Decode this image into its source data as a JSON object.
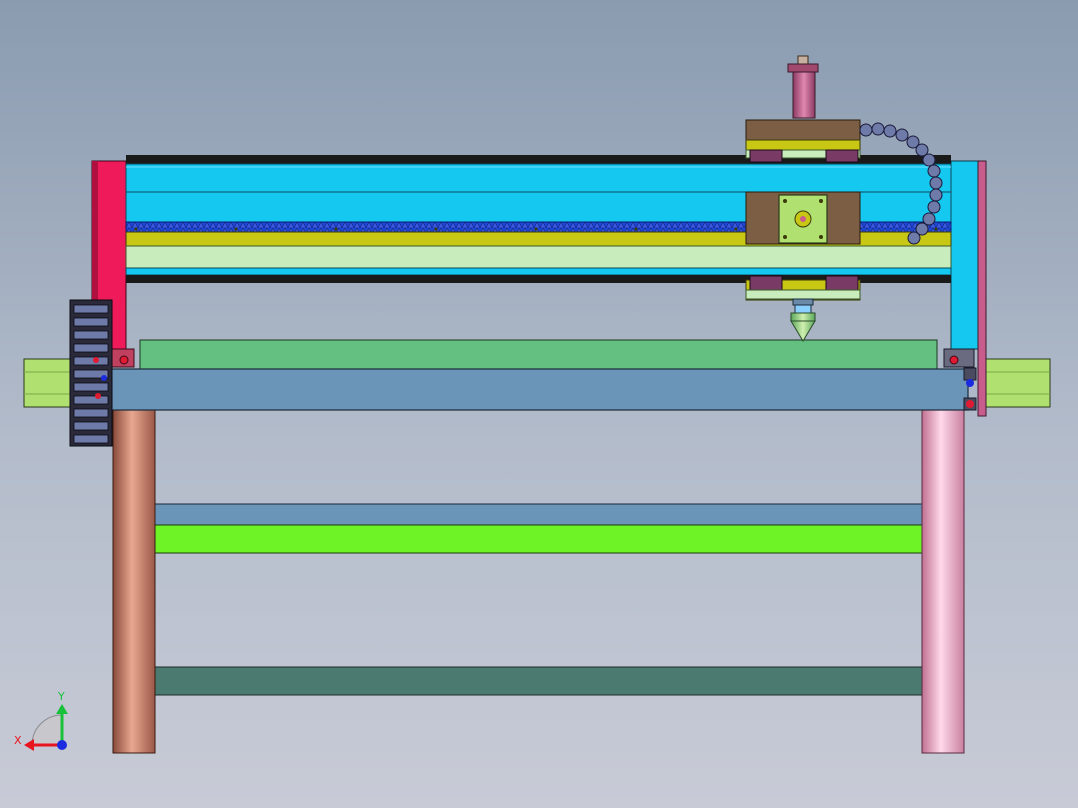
{
  "view": {
    "background_top": "#8a9bb0",
    "background_bottom": "#c8cbd6"
  },
  "triad": {
    "x_label": "X",
    "y_label": "Y",
    "x_color": "#e8141e",
    "y_color": "#17c23a",
    "z_color": "#1a2be0"
  },
  "palette": {
    "gantry_beam": "#14c8f0",
    "left_plate": "#ee1a5a",
    "right_plate": "#14c8f0",
    "gear_rack": "#1e46d2",
    "yellow_rail": "#c8c814",
    "linear_rail": "#c8ecbc",
    "carriage_plate": "#7c5e44",
    "stepper_motor": "#b0e070",
    "spindle_motor": "#c85c8c",
    "drag_chain": "#6e7aa8",
    "work_bed": "#64c080",
    "table_frame": "#6a94b8",
    "bar_green": "#6ef426",
    "bar_dark": "#4a7a70",
    "leg_left": "#c87860",
    "leg_right": "#f0a8c8"
  }
}
